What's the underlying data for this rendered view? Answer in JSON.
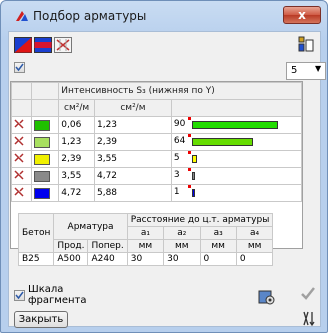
{
  "window": {
    "title": "Подбор арматуры",
    "close_label": "x"
  },
  "toolbar": {
    "count_select": {
      "value": "5",
      "arrow": "▼"
    }
  },
  "intensity_table": {
    "header": "Интенсивность S₃ (нижняя по Y)",
    "unit_from": "см²/м",
    "unit_to": "см²/м",
    "rows": [
      {
        "color": "#20c000",
        "from": "0,06",
        "to": "1,23",
        "percent": "90",
        "pct_value": 90,
        "bar_color": "#22dd00"
      },
      {
        "color": "#a8e060",
        "from": "1,23",
        "to": "2,39",
        "percent": "64",
        "pct_value": 64,
        "bar_color": "#66dd00"
      },
      {
        "color": "#f0f000",
        "from": "2,39",
        "to": "3,55",
        "percent": "5",
        "pct_value": 5,
        "bar_color": "#ffff00"
      },
      {
        "color": "#8a8a8a",
        "from": "3,55",
        "to": "4,72",
        "percent": "3",
        "pct_value": 3,
        "bar_color": "#888888"
      },
      {
        "color": "#0000ee",
        "from": "4,72",
        "to": "5,88",
        "percent": "1",
        "pct_value": 1,
        "bar_color": "#0000ee"
      }
    ]
  },
  "rebar_table": {
    "concrete_header": "Бетон",
    "rebar_header": "Арматура",
    "distance_header": "Расстояние до ц.т. арматуры",
    "long_label": "Прод.",
    "trans_label": "Попер.",
    "a_labels": [
      "a₁",
      "a₂",
      "a₃",
      "a₄"
    ],
    "mm": "мм",
    "values": {
      "concrete": "B25",
      "long": "A500",
      "trans": "A240",
      "a": [
        "30",
        "30",
        "0",
        "0"
      ]
    }
  },
  "fragment_scale": {
    "label_line1": "Шкала",
    "label_line2": "фрагмента"
  },
  "close_button": "Закрыть"
}
